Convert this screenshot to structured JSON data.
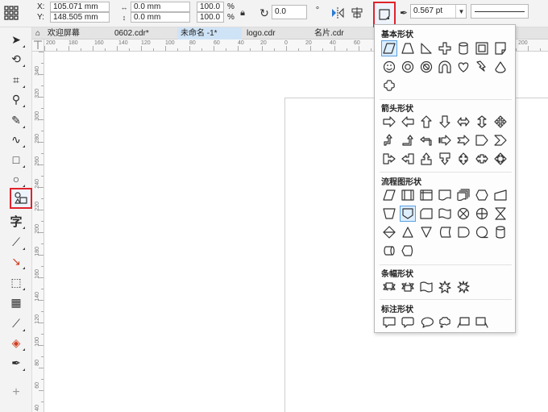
{
  "propbar": {
    "x_label": "X:",
    "y_label": "Y:",
    "x_value": "105.071 mm",
    "y_value": "148.505 mm",
    "w_value": "0.0 mm",
    "h_value": "0.0 mm",
    "scale_x": "100.0",
    "scale_y": "100.0",
    "pct": "%",
    "rotation": "0.0",
    "outline_width": "0.567 pt"
  },
  "tabs": [
    {
      "label": "欢迎屏幕"
    },
    {
      "label": "0602.cdr*"
    },
    {
      "label": "未命名 -1*"
    },
    {
      "label": "logo.cdr"
    },
    {
      "label": "名片.cdr"
    }
  ],
  "ruler": {
    "h_labels": [
      "200",
      "180",
      "160",
      "140",
      "120",
      "100",
      "80",
      "60",
      "40",
      "20",
      "0",
      "20",
      "40",
      "60",
      "200"
    ],
    "v_labels": [
      "340",
      "320",
      "300",
      "280",
      "260",
      "240",
      "220",
      "200",
      "180",
      "160",
      "140",
      "120",
      "100",
      "80",
      "60",
      "40"
    ]
  },
  "dropdown": {
    "sections": [
      {
        "title": "基本形状"
      },
      {
        "title": "箭头形状"
      },
      {
        "title": "流程图形状"
      },
      {
        "title": "条幅形状"
      },
      {
        "title": "标注形状"
      }
    ]
  },
  "colors": {
    "highlight_red": "#e0232b",
    "selected_blue": "#5aa0e0",
    "active_tab": "#cfe3f6"
  }
}
